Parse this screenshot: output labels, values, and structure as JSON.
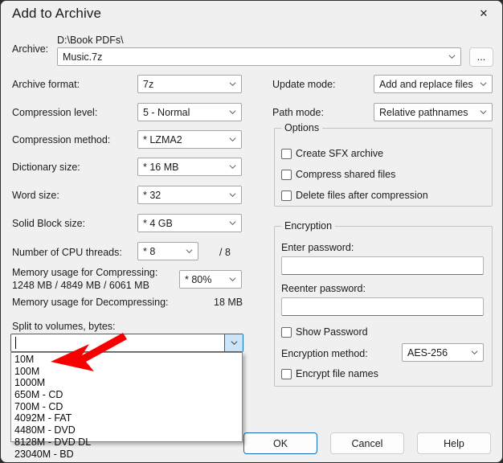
{
  "window": {
    "title": "Add to Archive",
    "close_icon": "close-icon"
  },
  "archive": {
    "label": "Archive:",
    "path": "D:\\Book PDFs\\",
    "value": "Music.7z",
    "browse_label": "...",
    "browse_icon": "ellipsis-icon"
  },
  "left_column": {
    "archive_format": {
      "label": "Archive format:",
      "value": "7z"
    },
    "compression_level": {
      "label": "Compression level:",
      "value": "5 - Normal"
    },
    "compression_method": {
      "label": "Compression method:",
      "value": "LZMA2",
      "star": "*"
    },
    "dictionary_size": {
      "label": "Dictionary size:",
      "value": "16 MB",
      "star": "*"
    },
    "word_size": {
      "label": "Word size:",
      "value": "32",
      "star": "*"
    },
    "solid_block_size": {
      "label": "Solid Block size:",
      "value": "4 GB",
      "star": "*"
    },
    "cpu_threads": {
      "label": "Number of CPU threads:",
      "value": "8",
      "star": "*",
      "total": "/ 8"
    },
    "memory_compress": {
      "label": "Memory usage for Compressing:",
      "values": "1248 MB / 4849 MB / 6061 MB",
      "percent": "80%",
      "star": "*"
    },
    "memory_decompress": {
      "label": "Memory usage for Decompressing:",
      "value": "18 MB"
    },
    "split_volumes": {
      "label": "Split to volumes, bytes:",
      "value": ""
    }
  },
  "volume_options": [
    "10M",
    "100M",
    "1000M",
    "650M - CD",
    "700M - CD",
    "4092M - FAT",
    "4480M - DVD",
    "8128M - DVD DL",
    "23040M - BD"
  ],
  "right_column": {
    "update_mode": {
      "label": "Update mode:",
      "value": "Add and replace files"
    },
    "path_mode": {
      "label": "Path mode:",
      "value": "Relative pathnames"
    },
    "options_group": {
      "title": "Options",
      "checkboxes": [
        {
          "label": "Create SFX archive",
          "checked": false
        },
        {
          "label": "Compress shared files",
          "checked": false
        },
        {
          "label": "Delete files after compression",
          "checked": false
        }
      ]
    },
    "encryption_group": {
      "title": "Encryption",
      "enter_password_label": "Enter password:",
      "enter_password_value": "",
      "reenter_password_label": "Reenter password:",
      "reenter_password_value": "",
      "show_password": {
        "label": "Show Password",
        "checked": false
      },
      "encryption_method_label": "Encryption method:",
      "encryption_method_value": "AES-256",
      "encrypt_file_names": {
        "label": "Encrypt file names",
        "checked": false
      }
    }
  },
  "buttons": {
    "ok": "OK",
    "cancel": "Cancel",
    "help": "Help"
  },
  "annotation": {
    "type": "arrow",
    "color": "#f90000",
    "name": "red-pointer-arrow"
  }
}
